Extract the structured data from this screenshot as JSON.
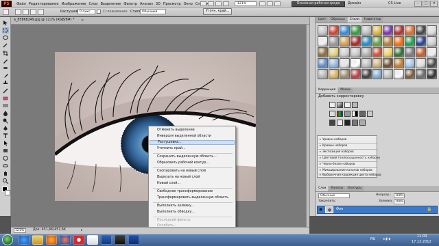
{
  "app": {
    "logo": "PS"
  },
  "menubar": {
    "items": [
      "Файл",
      "Редактирование",
      "Изображение",
      "Слои",
      "Выделение",
      "Фильтр",
      "Анализ",
      "3D",
      "Просмотр",
      "Окно",
      "Справка"
    ],
    "zoom": "121%",
    "workspace": "Основная рабочая среда",
    "workspace_more": "Дизайн",
    "cs_live": "CS Live",
    "window_controls": [
      "–",
      "□",
      "×"
    ]
  },
  "options": {
    "feather_label": "Растушевка:",
    "feather_value": "0 пикс",
    "smooth_label": "Сглаживание",
    "style_label": "Стиль:",
    "style_value": "Обычный",
    "refine_button": "Уточн. край..."
  },
  "document": {
    "tab_title": "a_85868249.jpg @ 121% (RGB/8#) *",
    "close": "×",
    "zoom_percent": "121%",
    "info": "Док: 451,6K/451,6K",
    "arrow": "▸"
  },
  "context_menu": {
    "items": [
      {
        "label": "Отменить выделение",
        "state": "normal"
      },
      {
        "label": "Инверсия выделенной области",
        "state": "normal"
      },
      {
        "label": "Растушевка...",
        "state": "highlight"
      },
      {
        "label": "Уточнить край...",
        "state": "normal"
      },
      {
        "label": "Сохранить выделенную область...",
        "state": "normal"
      },
      {
        "label": "Образовать рабочий контур...",
        "state": "normal"
      },
      {
        "label": "Скопировать на новый слой",
        "state": "normal"
      },
      {
        "label": "Вырезать на новый слой",
        "state": "normal"
      },
      {
        "label": "Новый слой...",
        "state": "normal"
      },
      {
        "label": "Свободное трансформирование",
        "state": "normal"
      },
      {
        "label": "Трансформировать выделенную область",
        "state": "normal"
      },
      {
        "label": "Выполнить заливку...",
        "state": "normal"
      },
      {
        "label": "Выполнить обводку...",
        "state": "normal"
      },
      {
        "label": "Последний фильтр",
        "state": "disabled"
      },
      {
        "label": "Ослабить...",
        "state": "disabled"
      }
    ]
  },
  "panels": {
    "top_tabs": [
      "Цвет",
      "Образцы",
      "Стили",
      "Навигатор"
    ],
    "top_active": "Стили",
    "adj_tabs": [
      "Коррекция",
      "Маски"
    ],
    "adj_active": "Коррекция",
    "adj_heading": "Добавить корректировку",
    "presets": [
      "Уровни наборов",
      "Кривые наборов",
      "Экспозиция наборов",
      "Цветовой тон/насыщенность наборов",
      "Черно-белое наборов",
      "Микширование каналов наборов",
      "Выборочная коррекция цвета наборов"
    ],
    "layer_tabs": [
      "Слои",
      "Каналы",
      "Контуры"
    ],
    "layer_active": "Слои",
    "blend": "Обычные",
    "opacity_label": "Непрозр.:",
    "opacity_value": "100%",
    "lock_label": "Закрепить:",
    "fill_label": "Заливка:",
    "fill_value": "100%",
    "layer_name": "Фон",
    "layer_eye": "◉",
    "layer_lock": "🔒"
  },
  "style_swatches": [
    "#c8c8c8",
    "#d83b2a",
    "#2e8be0",
    "#2f9a3e",
    "#c0c0c0",
    "#e6bb2a",
    "#7a2fb0",
    "#b32b2b",
    "#e06b2a",
    "#3f3f3f",
    "#dcdcdc",
    "#f2f2f2",
    "#9b9b9b",
    "#d9a04a",
    "#aa1e1e",
    "#1e8acb",
    "#64a13a",
    "#b87c32",
    "#ff6a00",
    "#1aa04a",
    "#1d3f91",
    "#d0d0d0",
    "#8a6b3a",
    "#e8d16f",
    "#cfcfcf",
    "#c9c9c9",
    "#b0b0b0",
    "#d84a2a",
    "#f1d35a",
    "#2b6f2b",
    "#7a7a7a",
    "#c75a2a",
    "#eeeeee",
    "#5a8ed1",
    "#8fb9e8",
    "#e6e6e6",
    "#ffffff",
    "#c0c0c0",
    "#d2b37a",
    "#6b4a2b",
    "#c87d2a",
    "#a6c8f0",
    "#e0e0e0",
    "#454545",
    "#b5b5b5",
    "#e0b25a",
    "#9c8c6c",
    "#ba3a3a",
    "#3a3a3a",
    "#7fb0df",
    "#bfbfbf",
    "#fafafa",
    "#7a5a3a",
    "#6a6a6a",
    "#2f2f2f"
  ],
  "taskbar": {
    "lang": "RU",
    "tray": "◂ ▮ ◖",
    "time": "11:03",
    "date": "17.12.2012"
  }
}
